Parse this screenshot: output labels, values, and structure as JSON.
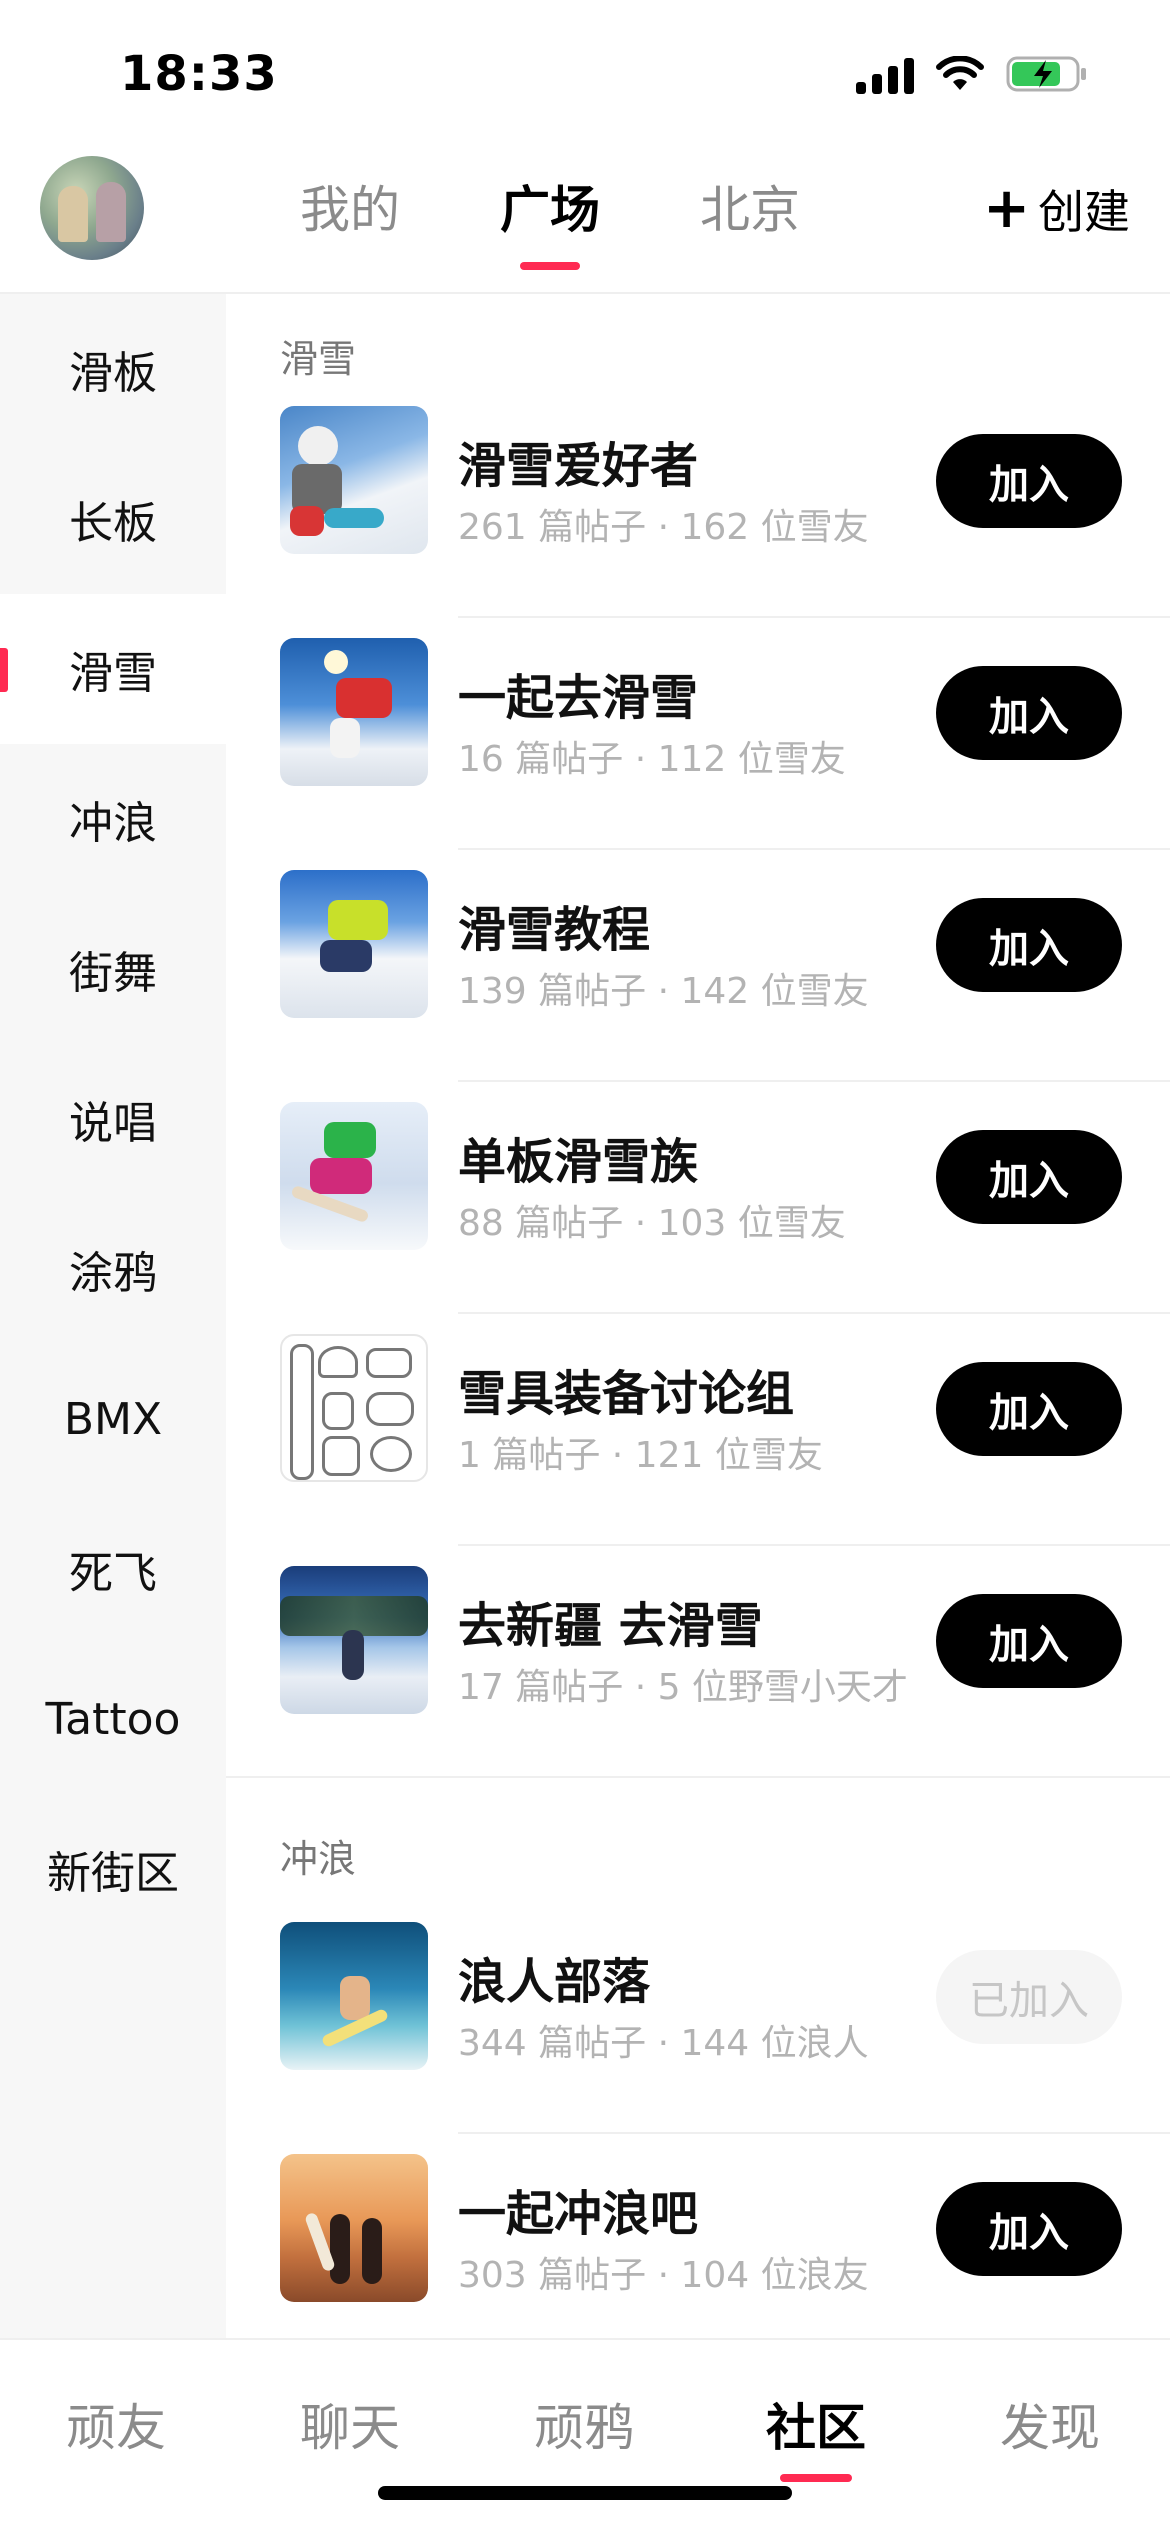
{
  "status_bar": {
    "time": "18:33"
  },
  "header": {
    "tabs": [
      {
        "label": "我的"
      },
      {
        "label": "广场"
      },
      {
        "label": "北京"
      }
    ],
    "active_tab": "广场",
    "create_label": "创建"
  },
  "rail": {
    "items": [
      {
        "label": "滑板"
      },
      {
        "label": "长板"
      },
      {
        "label": "滑雪"
      },
      {
        "label": "冲浪"
      },
      {
        "label": "街舞"
      },
      {
        "label": "说唱"
      },
      {
        "label": "涂鸦"
      },
      {
        "label": "BMX"
      },
      {
        "label": "死飞"
      },
      {
        "label": "Tattoo"
      },
      {
        "label": "新街区"
      }
    ],
    "active": "滑雪"
  },
  "sections": [
    {
      "title": "滑雪",
      "groups": [
        {
          "name": "滑雪爱好者",
          "meta": "261 篇帖子 · 162 位雪友",
          "button": "加入",
          "joined": false
        },
        {
          "name": "一起去滑雪",
          "meta": "16 篇帖子 · 112 位雪友",
          "button": "加入",
          "joined": false
        },
        {
          "name": "滑雪教程",
          "meta": "139 篇帖子 · 142 位雪友",
          "button": "加入",
          "joined": false
        },
        {
          "name": "单板滑雪族",
          "meta": "88 篇帖子 · 103 位雪友",
          "button": "加入",
          "joined": false
        },
        {
          "name": "雪具装备讨论组",
          "meta": "1 篇帖子 · 121 位雪友",
          "button": "加入",
          "joined": false
        },
        {
          "name": "去新疆 去滑雪",
          "meta": "17 篇帖子 · 5 位野雪小天才",
          "button": "加入",
          "joined": false
        }
      ]
    },
    {
      "title": "冲浪",
      "groups": [
        {
          "name": "浪人部落",
          "meta": "344 篇帖子 · 144 位浪人",
          "button": "已加入",
          "joined": true
        },
        {
          "name": "一起冲浪吧",
          "meta": "303 篇帖子 · 104 位浪友",
          "button": "加入",
          "joined": false
        }
      ]
    }
  ],
  "bottom_nav": {
    "items": [
      {
        "label": "顽友"
      },
      {
        "label": "聊天"
      },
      {
        "label": "顽鸦"
      },
      {
        "label": "社区"
      },
      {
        "label": "发现"
      }
    ],
    "active": "社区"
  },
  "colors": {
    "accent": "#ff2a52",
    "battery": "#34c759"
  }
}
